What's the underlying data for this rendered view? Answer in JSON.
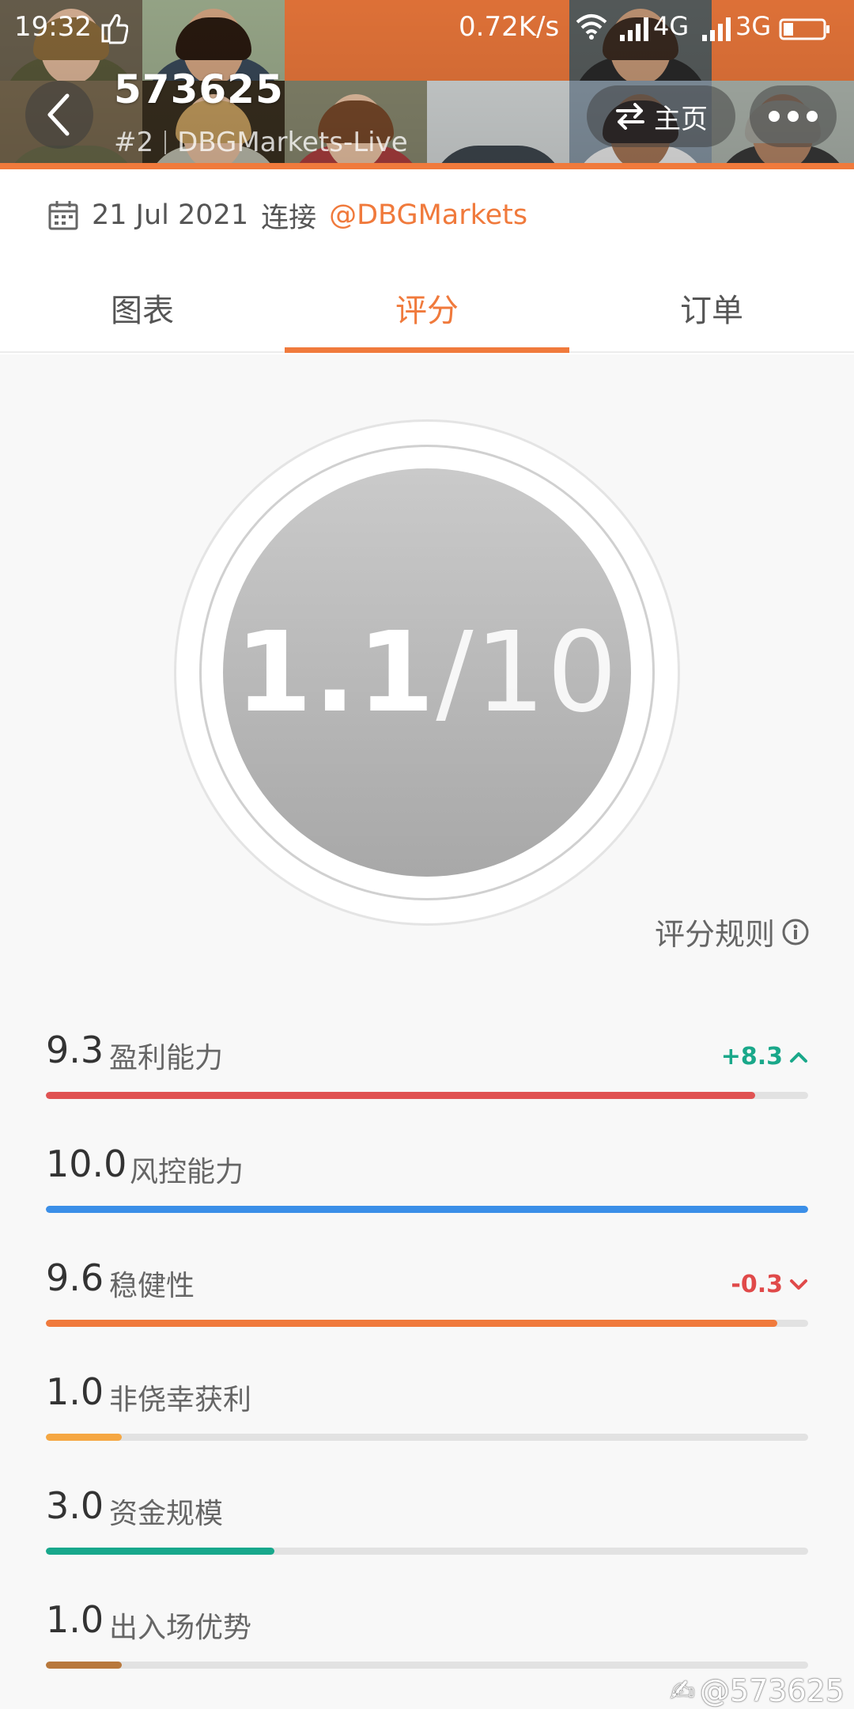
{
  "status_bar": {
    "time": "19:32",
    "net_speed": "0.72K/s",
    "net_4g": "4G",
    "net_3g": "3G"
  },
  "header": {
    "account_id": "573625",
    "rank": "#2",
    "server": "DBGMarkets-Live",
    "home_label": "主页",
    "accent": "#f07a3c"
  },
  "connection": {
    "date": "21 Jul 2021",
    "connect_label": "连接",
    "broker": "@DBGMarkets"
  },
  "tabs": [
    {
      "label": "图表",
      "active": false
    },
    {
      "label": "评分",
      "active": true
    },
    {
      "label": "订单",
      "active": false
    }
  ],
  "score": {
    "value": "1.1",
    "max": "/10"
  },
  "rules_label": "评分规则",
  "metrics": [
    {
      "value": "9.3",
      "label": "盈利能力",
      "change": "+8.3",
      "direction": "up",
      "level": 0.93,
      "color": "#e05353"
    },
    {
      "value": "10.0",
      "label": "风控能力",
      "change": "",
      "direction": "",
      "level": 1.0,
      "color": "#3b8fe8"
    },
    {
      "value": "9.6",
      "label": "稳健性",
      "change": "-0.3",
      "direction": "down",
      "level": 0.96,
      "color": "#f07a3c"
    },
    {
      "value": "1.0",
      "label": "非侥幸获利",
      "change": "",
      "direction": "",
      "level": 0.1,
      "color": "#f5a742"
    },
    {
      "value": "3.0",
      "label": "资金规模",
      "change": "",
      "direction": "",
      "level": 0.3,
      "color": "#18a88c"
    },
    {
      "value": "1.0",
      "label": "出入场优势",
      "change": "",
      "direction": "",
      "level": 0.1,
      "color": "#b8783c"
    }
  ],
  "watermark": "@573625"
}
